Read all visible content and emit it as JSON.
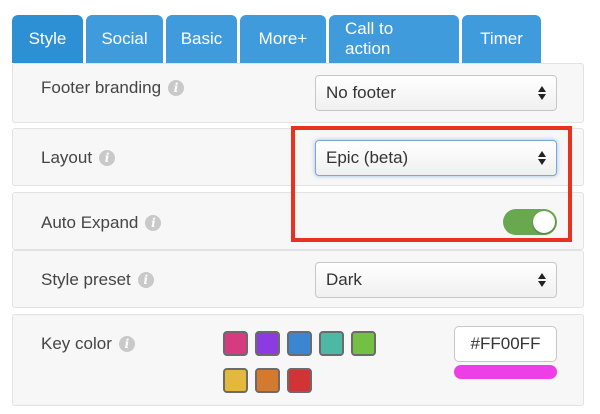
{
  "tabs": [
    {
      "label": "Style",
      "active": true
    },
    {
      "label": "Social",
      "active": false
    },
    {
      "label": "Basic",
      "active": false
    },
    {
      "label": "More+",
      "active": false
    },
    {
      "label": "Call to action",
      "active": false
    },
    {
      "label": "Timer",
      "active": false
    }
  ],
  "colors": {
    "tab_active": "#2d90d4",
    "tab_inactive": "#3f9bdb",
    "highlight_border": "#e8321f",
    "toggle_on": "#6aa84f"
  },
  "footer_branding": {
    "label": "Footer branding",
    "value": "No footer"
  },
  "layout": {
    "label": "Layout",
    "value": "Epic (beta)"
  },
  "auto_expand": {
    "label": "Auto Expand",
    "on": true
  },
  "style_preset": {
    "label": "Style preset",
    "value": "Dark"
  },
  "key_color": {
    "label": "Key color",
    "value": "#FF00FF",
    "preview_color": "#ee3ee8",
    "swatches": [
      "#d63a7f",
      "#8b3bdf",
      "#3b86d1",
      "#4fb8a4",
      "#74c043",
      "#e4b83c",
      "#d5792e",
      "#d13434"
    ]
  },
  "info_icon_glyph": "i"
}
